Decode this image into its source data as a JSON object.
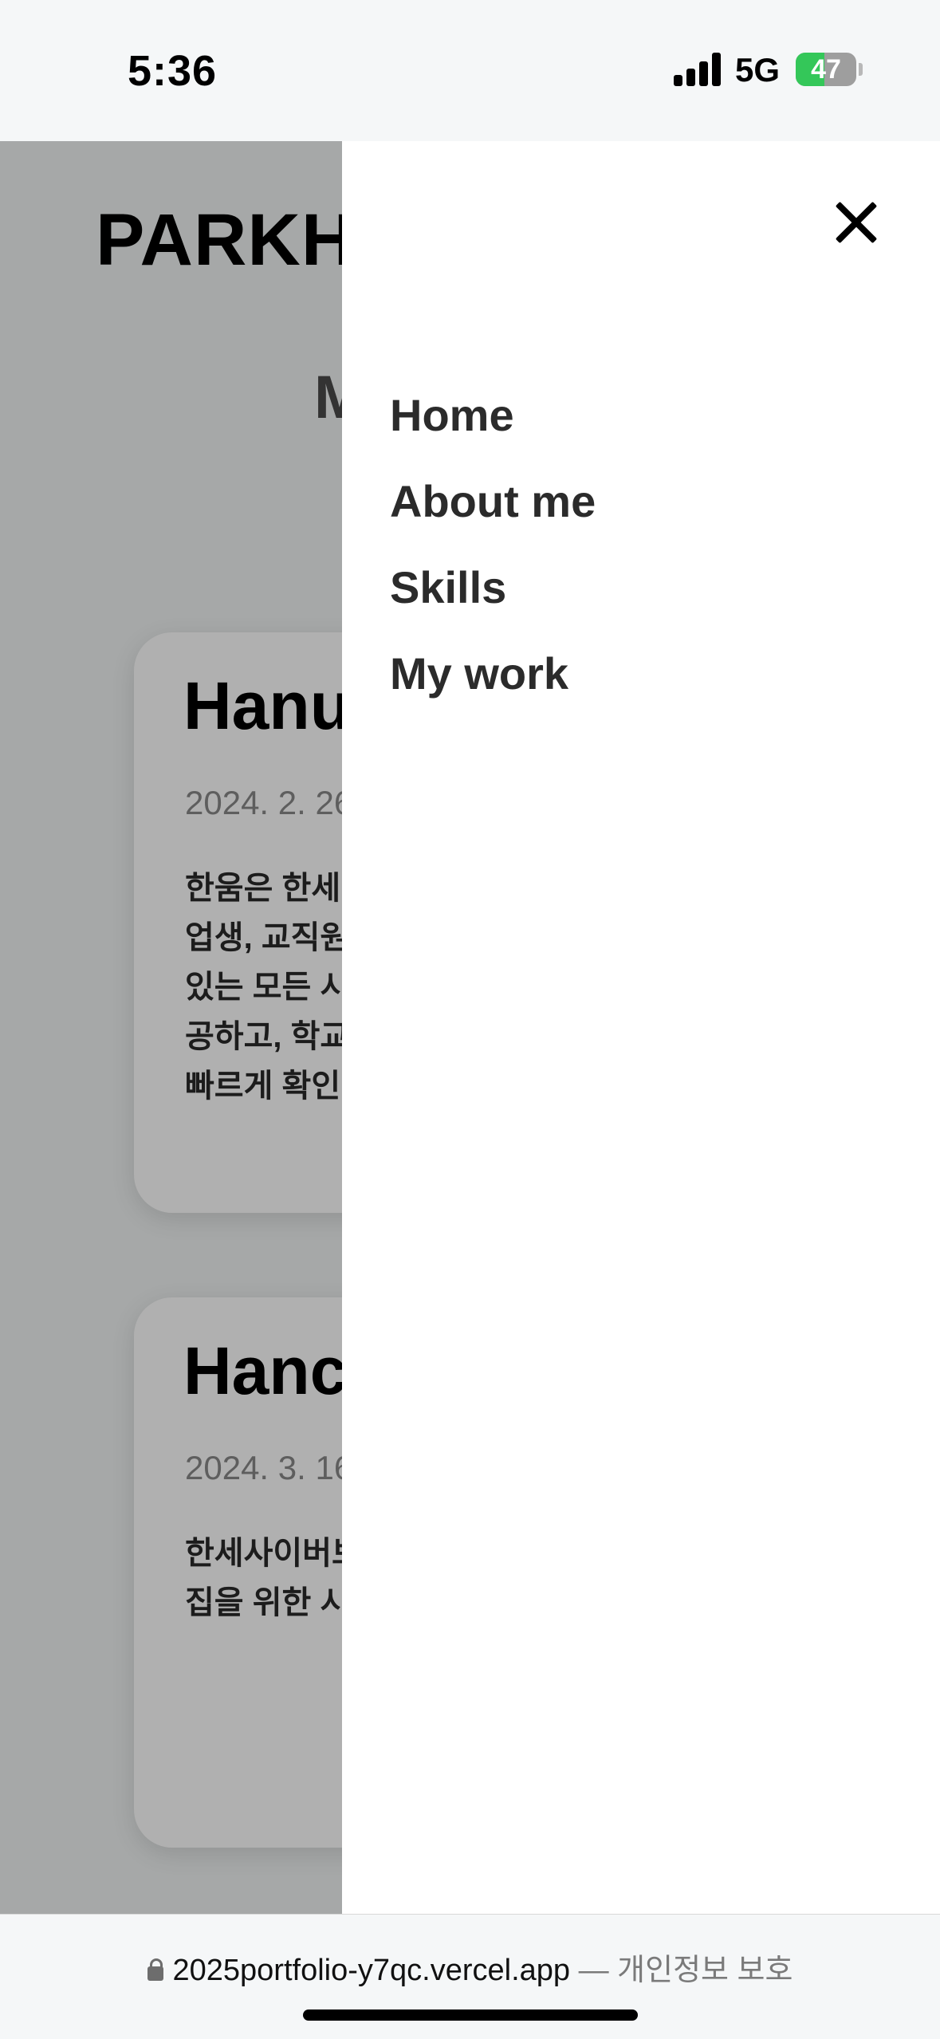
{
  "status_bar": {
    "time": "5:36",
    "network": "5G",
    "battery": "47",
    "battery_level": 0.47
  },
  "background_page": {
    "logo": "PARKHA",
    "section_heading": "M",
    "cards": [
      {
        "title": "Hanu",
        "date": "2024. 2. 26",
        "description_lines": [
          "한움은 한세",
          "업생, 교직원",
          "있는 모든 시",
          "공하고, 학교",
          "빠르게 확인"
        ]
      },
      {
        "title": "Hanc",
        "date": "2024. 3. 16",
        "description_lines": [
          "한세사이버보",
          "집을 위한 시"
        ]
      }
    ]
  },
  "drawer": {
    "close_icon": "close-icon",
    "menu": [
      {
        "label": "Home"
      },
      {
        "label": "About me"
      },
      {
        "label": "Skills"
      },
      {
        "label": "My work"
      }
    ]
  },
  "url_bar": {
    "host": "2025portfolio-y7qc.vercel.app",
    "separator": " — ",
    "privacy": "개인정보 보호"
  },
  "colors": {
    "overlay": "#a6a8a8",
    "drawer_bg": "#ffffff",
    "menu_text": "#2b2b2b",
    "battery_green": "#34c759"
  }
}
